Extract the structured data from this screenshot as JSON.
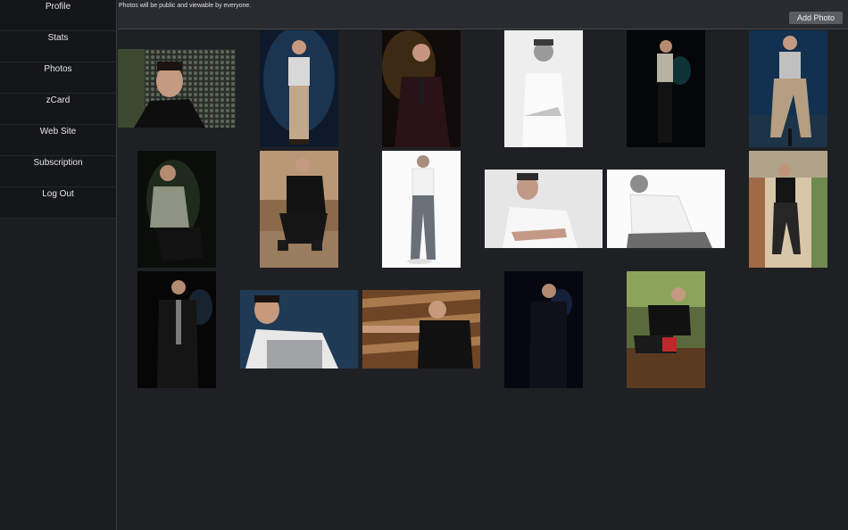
{
  "sidebar": {
    "items": [
      {
        "label": "Profile"
      },
      {
        "label": "Stats"
      },
      {
        "label": "Photos"
      },
      {
        "label": "zCard"
      },
      {
        "label": "Web Site"
      },
      {
        "label": "Subscription"
      },
      {
        "label": "Log Out"
      }
    ]
  },
  "header": {
    "notice": "Photos will be public and viewable by everyone.",
    "add_photo_label": "Add Photo"
  }
}
